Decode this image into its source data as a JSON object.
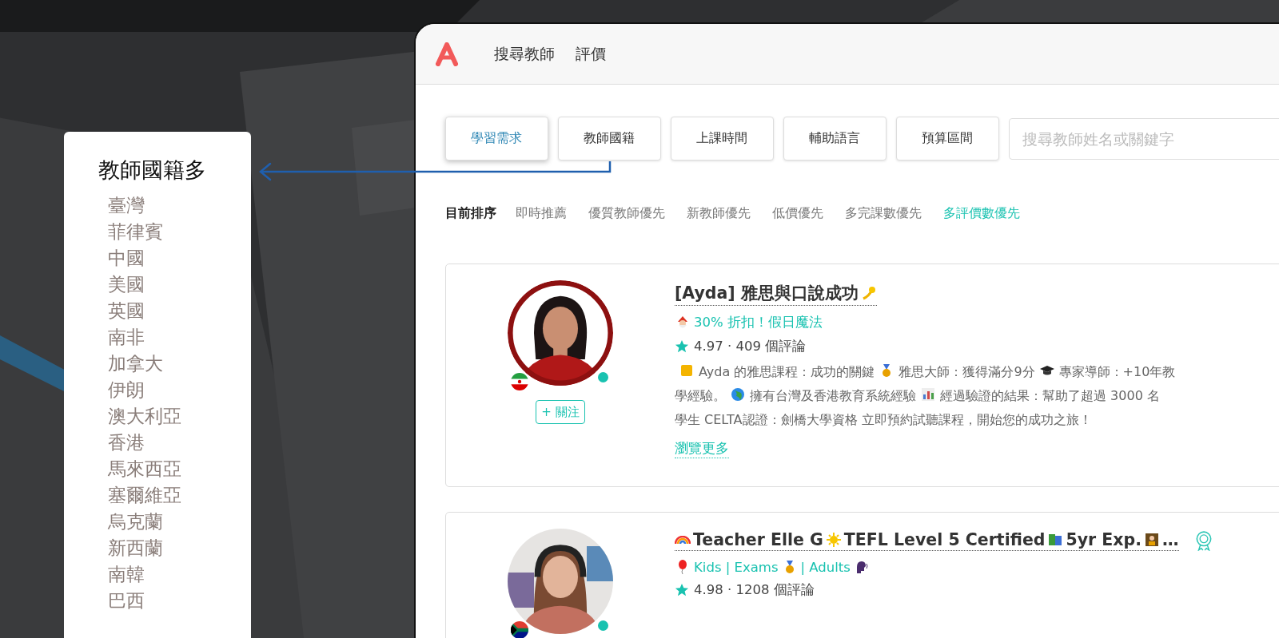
{
  "panel": {
    "title": "教師國籍多",
    "items": [
      "臺灣",
      "菲律賓",
      "中國",
      "美國",
      "英國",
      "南非",
      "加拿大",
      "伊朗",
      "澳大利亞",
      "香港",
      "馬來西亞",
      "塞爾維亞",
      "烏克蘭",
      "新西蘭",
      "南韓",
      "巴西"
    ]
  },
  "nav": {
    "tabs": [
      "搜尋教師",
      "評價"
    ]
  },
  "filters": [
    {
      "label": "學習需求",
      "selected": true
    },
    {
      "label": "教師國籍",
      "selected": false
    },
    {
      "label": "上課時間",
      "selected": false
    },
    {
      "label": "輔助語言",
      "selected": false
    },
    {
      "label": "預算區間",
      "selected": false
    }
  ],
  "search": {
    "placeholder": "搜尋教師姓名或關鍵字"
  },
  "sort": {
    "label": "目前排序",
    "options": [
      {
        "label": "即時推薦",
        "selected": false
      },
      {
        "label": "優質教師優先",
        "selected": false
      },
      {
        "label": "新教師優先",
        "selected": false
      },
      {
        "label": "低價優先",
        "selected": false
      },
      {
        "label": "多完課數優先",
        "selected": false
      },
      {
        "label": "多評價數優先",
        "selected": true
      }
    ]
  },
  "teachers": [
    {
      "ring": true,
      "online": true,
      "badge": false,
      "title": [
        {
          "kind": "text",
          "text": "[Ayda] 雅思與口說成功"
        },
        {
          "kind": "comet"
        }
      ],
      "promo": [
        {
          "kind": "santa"
        },
        {
          "kind": "text",
          "text": "30% 折扣！假日魔法"
        }
      ],
      "rating": "4.97 · 409 個評論",
      "description": [
        {
          "kind": "square"
        },
        {
          "kind": "text",
          "text": "Ayda 的雅思課程：成功的關鍵"
        },
        {
          "kind": "medal"
        },
        {
          "kind": "text",
          "text": "雅思大師：獲得滿分9分"
        },
        {
          "kind": "cap"
        },
        {
          "kind": "text",
          "text": "專家導師：+10年教"
        },
        {
          "kind": "text",
          "text": "學經驗。"
        },
        {
          "kind": "globe"
        },
        {
          "kind": "text",
          "text": "擁有台灣及香港教育系統經驗"
        },
        {
          "kind": "chart"
        },
        {
          "kind": "text",
          "text": "經過驗證的結果：幫助了超過 3000 名"
        },
        {
          "kind": "text",
          "text": "學生 CELTA認證：劍橋大學資格 立即預約試聽課程，開始您的成功之旅！"
        }
      ],
      "follow": "+ 關注",
      "more": "瀏覽更多"
    },
    {
      "ring": false,
      "online": true,
      "title": [
        {
          "kind": "rainbow"
        },
        {
          "kind": "text",
          "text": "Teacher Elle G"
        },
        {
          "kind": "sun"
        },
        {
          "kind": "text",
          "text": "TEFL Level 5 Certified"
        },
        {
          "kind": "books"
        },
        {
          "kind": "text",
          "text": "5yr Exp."
        },
        {
          "kind": "teacher"
        },
        {
          "kind": "text",
          "text": "…"
        }
      ],
      "badge": true,
      "promo": [
        {
          "kind": "balloon"
        },
        {
          "kind": "text",
          "text": "Kids | Exams"
        },
        {
          "kind": "medal"
        },
        {
          "kind": "text",
          "text": "| Adults"
        },
        {
          "kind": "speaker"
        }
      ],
      "rating": "4.98 · 1208 個評論"
    }
  ]
}
